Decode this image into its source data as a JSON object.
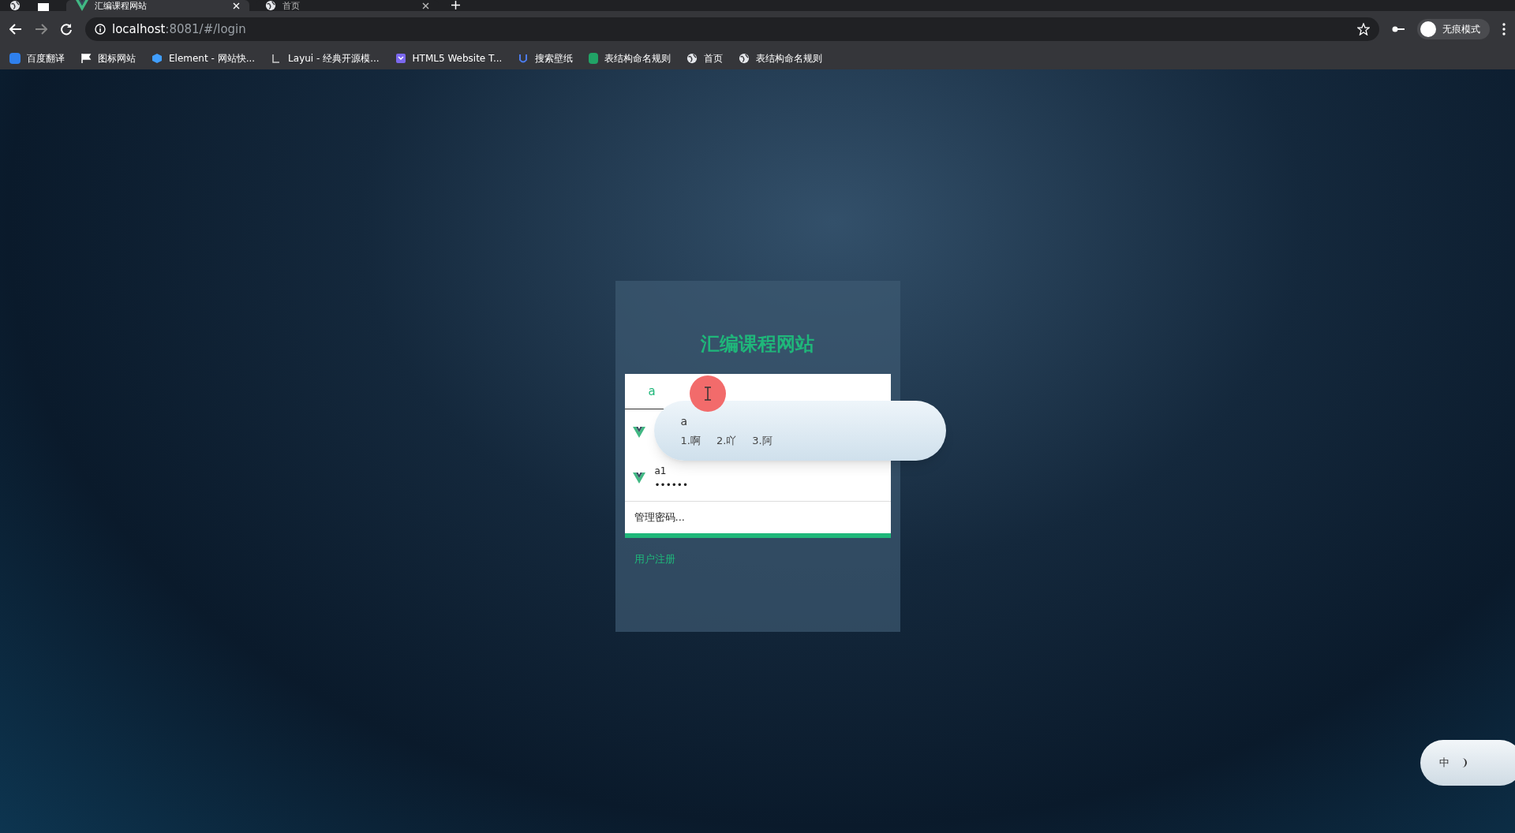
{
  "tabs": [
    {
      "title": "汇编课程网站",
      "selected": true
    },
    {
      "title": "首页",
      "selected": false
    }
  ],
  "address_bar": {
    "host": "localhost",
    "path": ":8081/#/login"
  },
  "bookmarks": [
    {
      "label": "百度翻译",
      "kind": "translate"
    },
    {
      "label": "图标网站",
      "kind": "flag"
    },
    {
      "label": "Element - 网站快...",
      "kind": "hex"
    },
    {
      "label": "Layui - 经典开源模...",
      "kind": "layui"
    },
    {
      "label": "HTML5 Website T...",
      "kind": "html"
    },
    {
      "label": "搜索壁纸",
      "kind": "wallpaper"
    },
    {
      "label": "表结构命名规则",
      "kind": "sheet"
    },
    {
      "label": "首页",
      "kind": "globe"
    },
    {
      "label": "表结构命名规则",
      "kind": "globe"
    }
  ],
  "profile": {
    "label": "无痕模式"
  },
  "login": {
    "title": "汇编课程网站",
    "username_value": "a",
    "saved_logins": [
      {
        "username": "a1",
        "password": "••••••"
      }
    ],
    "manage_passwords": "管理密码...",
    "link": "用户注册"
  },
  "ime": {
    "composition": "a",
    "candidates": [
      "1.啊",
      "2.吖",
      "3.阿"
    ]
  },
  "ime_toolbar": {
    "mode": "中"
  }
}
